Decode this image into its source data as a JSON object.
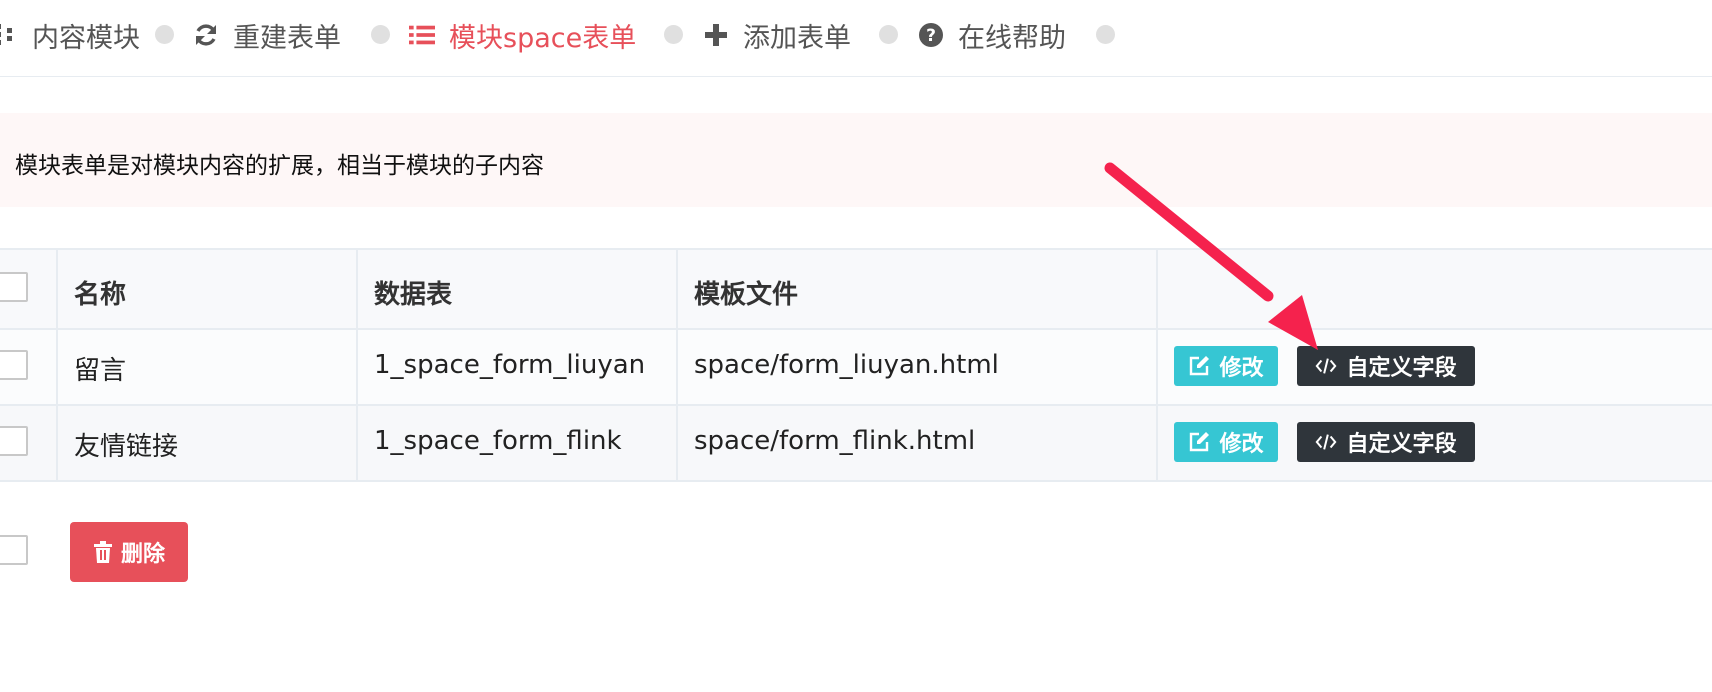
{
  "nav": {
    "items": [
      {
        "label": "内容模块",
        "icon": "sitemap-icon",
        "active": false
      },
      {
        "label": "重建表单",
        "icon": "refresh-icon",
        "active": false
      },
      {
        "label": "模块space表单",
        "icon": "list-icon",
        "active": true
      },
      {
        "label": "添加表单",
        "icon": "plus-icon",
        "active": false
      },
      {
        "label": "在线帮助",
        "icon": "question-circle-icon",
        "active": false
      }
    ]
  },
  "note": {
    "text": "模块表单是对模块内容的扩展，相当于模块的子内容"
  },
  "table": {
    "headers": [
      "名称",
      "数据表",
      "模板文件",
      ""
    ],
    "rows": [
      {
        "name": "留言",
        "table": "1_space_form_liuyan",
        "template": "space/form_liuyan.html",
        "edit_label": "修改",
        "field_label": "自定义字段"
      },
      {
        "name": "友情链接",
        "table": "1_space_form_flink",
        "template": "space/form_flink.html",
        "edit_label": "修改",
        "field_label": "自定义字段"
      }
    ]
  },
  "footer": {
    "delete_label": "删除"
  },
  "colors": {
    "active": "#e7505a",
    "edit_button": "#36c6d3",
    "field_button": "#2f353b",
    "delete_button": "#e7505a",
    "arrow": "#f5224d",
    "note_bg": "#fef7f7"
  }
}
